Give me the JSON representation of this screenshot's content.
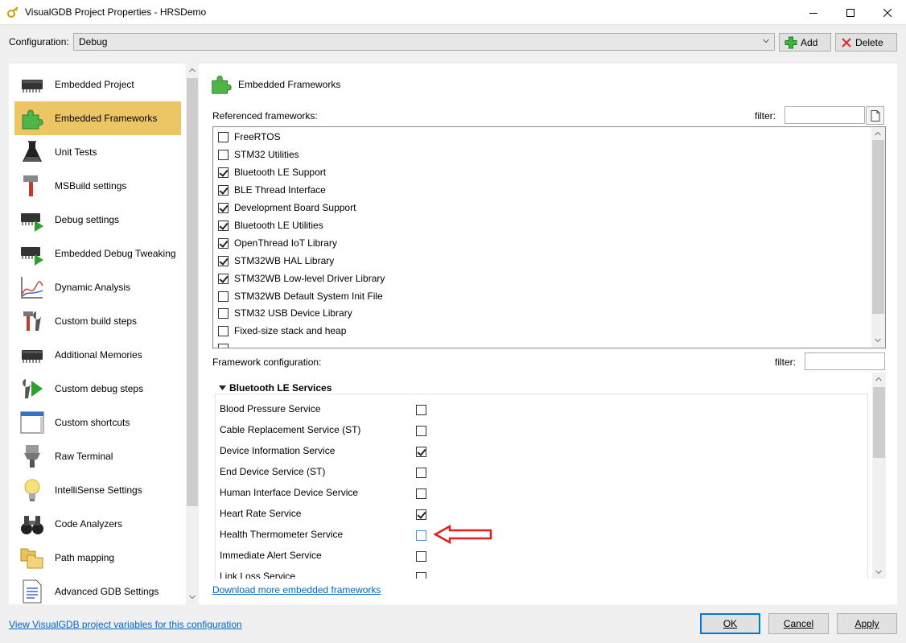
{
  "window": {
    "title": "VisualGDB Project Properties - HRSDemo"
  },
  "config": {
    "label": "Configuration:",
    "value": "Debug",
    "add_label": "Add",
    "delete_label": "Delete"
  },
  "sidebar": {
    "items": [
      {
        "label": "Embedded Project",
        "icon": "chip-icon"
      },
      {
        "label": "Embedded Frameworks",
        "icon": "puzzle-icon",
        "selected": true
      },
      {
        "label": "Unit Tests",
        "icon": "flask-icon"
      },
      {
        "label": "MSBuild settings",
        "icon": "hammer-icon"
      },
      {
        "label": "Debug settings",
        "icon": "chip-play-icon"
      },
      {
        "label": "Embedded Debug Tweaking",
        "icon": "chip-play-icon"
      },
      {
        "label": "Dynamic Analysis",
        "icon": "graph-icon"
      },
      {
        "label": "Custom build steps",
        "icon": "tools-icon"
      },
      {
        "label": "Additional Memories",
        "icon": "chip-icon"
      },
      {
        "label": "Custom debug steps",
        "icon": "wrench-play-icon"
      },
      {
        "label": "Custom shortcuts",
        "icon": "window-icon"
      },
      {
        "label": "Raw Terminal",
        "icon": "serial-connector-icon"
      },
      {
        "label": "IntelliSense Settings",
        "icon": "lightbulb-icon"
      },
      {
        "label": "Code Analyzers",
        "icon": "binoculars-icon"
      },
      {
        "label": "Path mapping",
        "icon": "folders-icon"
      },
      {
        "label": "Advanced GDB Settings",
        "icon": "document-icon"
      }
    ]
  },
  "main": {
    "title": "Embedded Frameworks",
    "referenced_label": "Referenced frameworks:",
    "filter_label": "filter:",
    "frameworks": [
      {
        "label": "FreeRTOS",
        "checked": false
      },
      {
        "label": "STM32 Utilities",
        "checked": false
      },
      {
        "label": "Bluetooth LE Support",
        "checked": true
      },
      {
        "label": "BLE Thread Interface",
        "checked": true
      },
      {
        "label": "Development Board Support",
        "checked": true
      },
      {
        "label": "Bluetooth LE Utilities",
        "checked": true
      },
      {
        "label": "OpenThread IoT Library",
        "checked": true
      },
      {
        "label": "STM32WB HAL Library",
        "checked": true
      },
      {
        "label": "STM32WB Low-level Driver Library",
        "checked": true
      },
      {
        "label": "STM32WB Default System Init File",
        "checked": false
      },
      {
        "label": "STM32 USB Device Library",
        "checked": false
      },
      {
        "label": "Fixed-size stack and heap",
        "checked": false
      }
    ],
    "config_label": "Framework configuration:",
    "config_section": "Bluetooth LE Services",
    "services": [
      {
        "label": "Blood Pressure Service",
        "checked": false
      },
      {
        "label": "Cable Replacement Service (ST)",
        "checked": false
      },
      {
        "label": "Device Information Service",
        "checked": true
      },
      {
        "label": "End Device Service (ST)",
        "checked": false
      },
      {
        "label": "Human Interface Device Service",
        "checked": false
      },
      {
        "label": "Heart Rate Service",
        "checked": true
      },
      {
        "label": "Health Thermometer Service",
        "checked": false,
        "highlighted": true
      },
      {
        "label": "Immediate Alert Service",
        "checked": false
      },
      {
        "label": "Link Loss Service",
        "checked": false
      }
    ],
    "download_link": "Download more embedded frameworks"
  },
  "footer": {
    "variables_link": "View VisualGDB project variables for this configuration",
    "ok_label": "OK",
    "cancel_label": "Cancel",
    "apply_label": "Apply"
  },
  "colors": {
    "selected_nav": "#ecc565",
    "link": "#0066cc",
    "arrow": "#e02020"
  }
}
